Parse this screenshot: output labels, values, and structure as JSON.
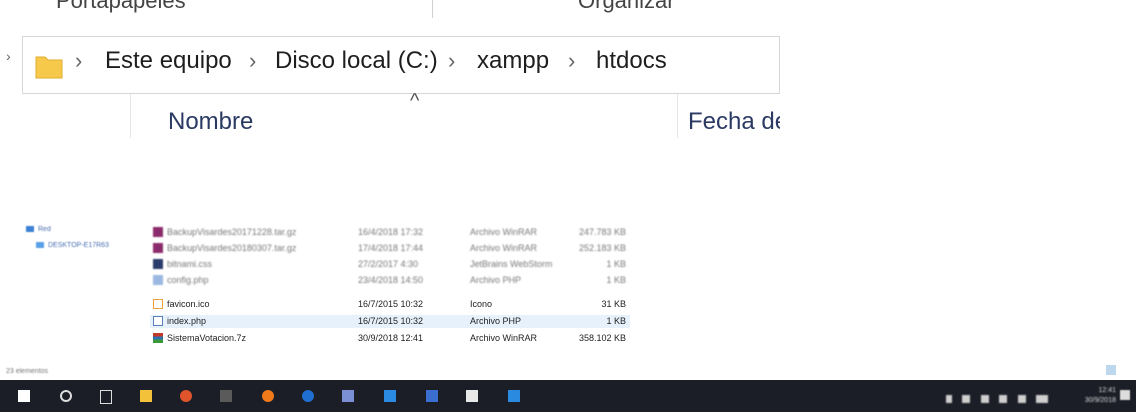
{
  "ribbon": {
    "left_label": "Portapapeles",
    "right_label": "Organizar"
  },
  "address": {
    "crumbs": [
      "Este equipo",
      "Disco local (C:)",
      "xampp",
      "htdocs"
    ]
  },
  "columns": {
    "name": "Nombre",
    "date": "Fecha de"
  },
  "nav": {
    "items": [
      "Red",
      "DESKTOP-E17R63"
    ]
  },
  "files": [
    {
      "name": "BackupVisardes20171228.tar.gz",
      "date": "16/4/2018 17:32",
      "type": "Archivo WinRAR",
      "size": "247.783 KB",
      "icon": "winrar-icon",
      "blurred": true
    },
    {
      "name": "BackupVisardes20180307.tar.gz",
      "date": "17/4/2018 17:44",
      "type": "Archivo WinRAR",
      "size": "252.183 KB",
      "icon": "winrar-icon",
      "blurred": true
    },
    {
      "name": "bitnami.css",
      "date": "27/2/2017 4:30",
      "type": "JetBrains WebStorm",
      "size": "1 KB",
      "icon": "css-file-icon",
      "blurred": true
    },
    {
      "name": "config.php",
      "date": "23/4/2018 14:50",
      "type": "Archivo PHP",
      "size": "1 KB",
      "icon": "php-file-icon",
      "blurred": true
    },
    {
      "name": "favicon.ico",
      "date": "16/7/2015 10:32",
      "type": "Icono",
      "size": "31 KB",
      "icon": "ico-file-icon",
      "blurred": false
    },
    {
      "name": "index.php",
      "date": "16/7/2015 10:32",
      "type": "Archivo PHP",
      "size": "1 KB",
      "icon": "php-file-icon",
      "blurred": false,
      "selected": true
    },
    {
      "name": "SistemaVotacion.7z",
      "date": "30/9/2018 12:41",
      "type": "Archivo WinRAR",
      "size": "358.102 KB",
      "icon": "winrar-icon",
      "blurred": false
    }
  ],
  "status": {
    "count": "23 elementos"
  },
  "taskbar": {
    "clock_time": "12:41",
    "clock_date": "30/9/2018"
  },
  "colors": {
    "taskbar": "#1b1d27",
    "selected_row": "#e6f1fb",
    "folder": "#f6c94a"
  }
}
